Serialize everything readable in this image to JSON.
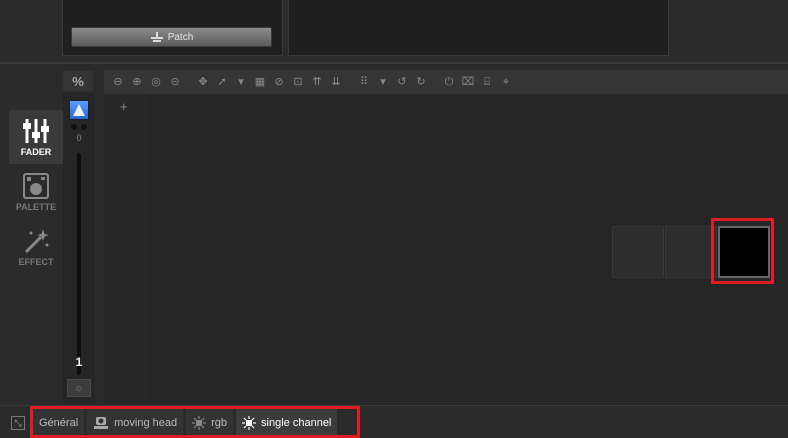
{
  "top": {
    "patch_label": "Patch"
  },
  "sidebar": {
    "modes": [
      {
        "label": "FADER",
        "icon": "fader-icon",
        "active": true
      },
      {
        "label": "PALETTE",
        "icon": "palette-icon",
        "active": false
      },
      {
        "label": "EFFECT",
        "icon": "effect-wand-icon",
        "active": false
      }
    ]
  },
  "fader": {
    "percent_label": "%",
    "value": "0",
    "number": "1"
  },
  "toolbar": {
    "icons": [
      "zoom-out-icon",
      "zoom-in-icon",
      "zoom-reset-icon",
      "back-icon",
      "move-icon",
      "select-icon",
      "dropdown-icon",
      "grid-icon",
      "disable-icon",
      "fit-icon",
      "align-up-icon",
      "align-down-icon",
      "matrix-icon",
      "dropdown-icon",
      "rotate-left-icon",
      "rotate-right-icon",
      "power-icon",
      "fixture-remove-icon",
      "fixture-add-icon",
      "target-icon"
    ]
  },
  "workspace": {
    "add_symbol": "+"
  },
  "bottom_tabs": [
    {
      "label": "Général",
      "icon": "",
      "active": false
    },
    {
      "label": "moving head",
      "icon": "moving-head-icon",
      "active": false
    },
    {
      "label": "rgb",
      "icon": "light-icon",
      "active": false
    },
    {
      "label": "single channel",
      "icon": "light-bright-icon",
      "active": true
    }
  ],
  "colors": {
    "highlight": "#e01c24",
    "background": "#2b2b2b",
    "selected_cell": "#000000"
  }
}
